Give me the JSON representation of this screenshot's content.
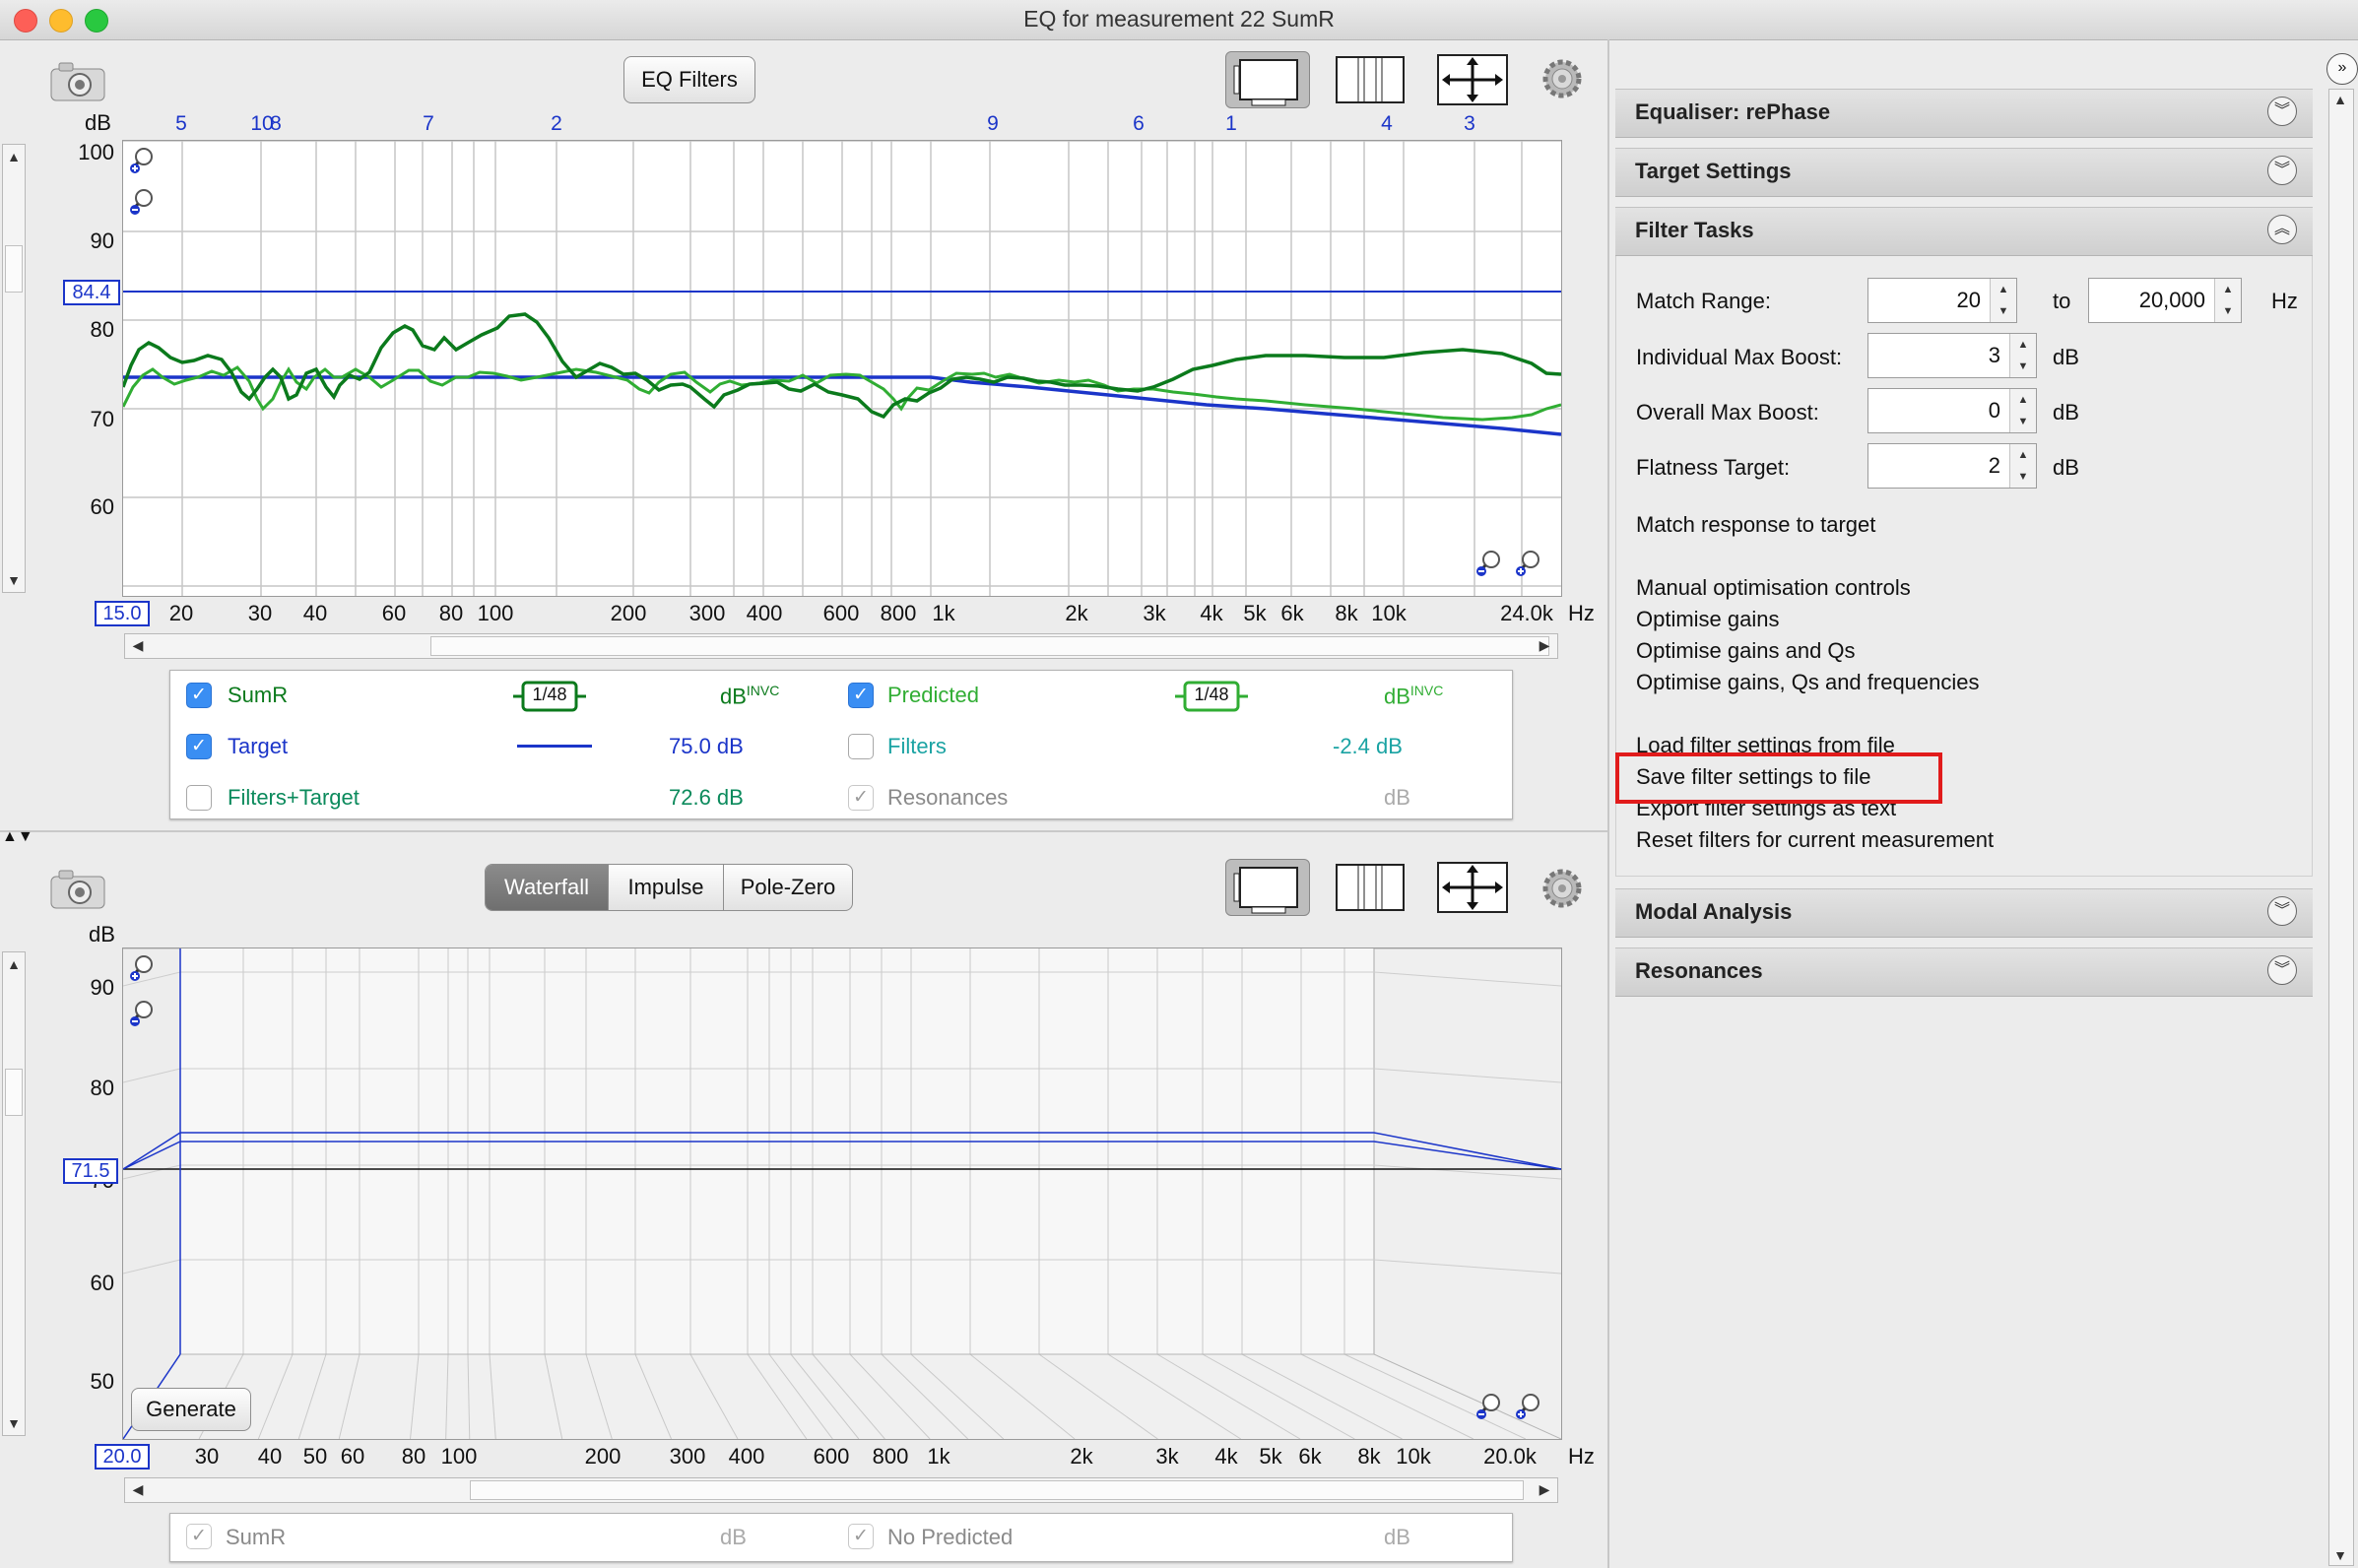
{
  "window": {
    "title": "EQ for measurement 22 SumR"
  },
  "colors": {
    "target": "#1b35c9",
    "sumr": "#0b7a1c",
    "predicted": "#30ad33",
    "highlight": "#e11b1b",
    "filters": "#1aa3a3"
  },
  "top_panel": {
    "eq_filters_button": "EQ Filters",
    "y_unit": "dB",
    "y_ticks": [
      "100",
      "90",
      "80",
      "70",
      "60"
    ],
    "target_level_box": "84.4",
    "x_start_box": "15.0",
    "x_ticks": [
      "20",
      "30",
      "40",
      "60",
      "80",
      "100",
      "200",
      "300",
      "400",
      "600",
      "800",
      "1k",
      "2k",
      "3k",
      "4k",
      "5k",
      "6k",
      "8k",
      "10k",
      "24.0k"
    ],
    "x_unit": "Hz",
    "filter_markers": [
      "5",
      "10",
      "8",
      "7",
      "2",
      "9",
      "6",
      "1",
      "4",
      "3"
    ]
  },
  "legend_top": {
    "sumr": {
      "label": "SumR",
      "smoothing": "1/48",
      "value": "dB",
      "suffix": "INVC"
    },
    "predicted": {
      "label": "Predicted",
      "smoothing": "1/48",
      "value": "dB",
      "suffix": "INVC"
    },
    "target": {
      "label": "Target",
      "value": "75.0 dB"
    },
    "filters": {
      "label": "Filters",
      "value": "-2.4 dB"
    },
    "filters_target": {
      "label": "Filters+Target",
      "value": "72.6 dB"
    },
    "resonances": {
      "label": "Resonances",
      "value": "dB"
    }
  },
  "bottom_panel": {
    "tabs": [
      "Waterfall",
      "Impulse",
      "Pole-Zero"
    ],
    "y_unit": "dB",
    "y_ticks": [
      "90",
      "80",
      "70",
      "60",
      "50"
    ],
    "level_box": "71.5",
    "x_start_box": "20.0",
    "x_ticks": [
      "30",
      "40",
      "50",
      "60",
      "80",
      "100",
      "200",
      "300",
      "400",
      "600",
      "800",
      "1k",
      "2k",
      "3k",
      "4k",
      "5k",
      "6k",
      "8k",
      "10k",
      "20.0k"
    ],
    "x_unit": "Hz",
    "generate_button": "Generate"
  },
  "legend_bottom": {
    "sumr": {
      "label": "SumR",
      "value": "dB"
    },
    "no_predicted": {
      "label": "No Predicted",
      "value": "dB"
    }
  },
  "right_panel": {
    "sections": {
      "equaliser": "Equaliser: rePhase",
      "target_settings": "Target Settings",
      "filter_tasks": "Filter Tasks",
      "modal_analysis": "Modal Analysis",
      "resonances": "Resonances"
    },
    "match_range": {
      "label": "Match Range:",
      "from": "20",
      "to_label": "to",
      "to": "20,000",
      "unit": "Hz"
    },
    "individual_max_boost": {
      "label": "Individual Max Boost:",
      "value": "3",
      "unit": "dB"
    },
    "overall_max_boost": {
      "label": "Overall Max Boost:",
      "value": "0",
      "unit": "dB"
    },
    "flatness_target": {
      "label": "Flatness Target:",
      "value": "2",
      "unit": "dB"
    },
    "actions": {
      "match_response": "Match response to target",
      "manual_controls": "Manual optimisation controls",
      "optimise_gains": "Optimise gains",
      "optimise_gains_qs": "Optimise gains and Qs",
      "optimise_gains_qs_freq": "Optimise gains, Qs and frequencies",
      "load_filter": "Load filter settings from file",
      "save_filter": "Save filter settings to file",
      "export_filter": "Export filter settings as text",
      "reset_filters": "Reset filters for current measurement"
    }
  }
}
